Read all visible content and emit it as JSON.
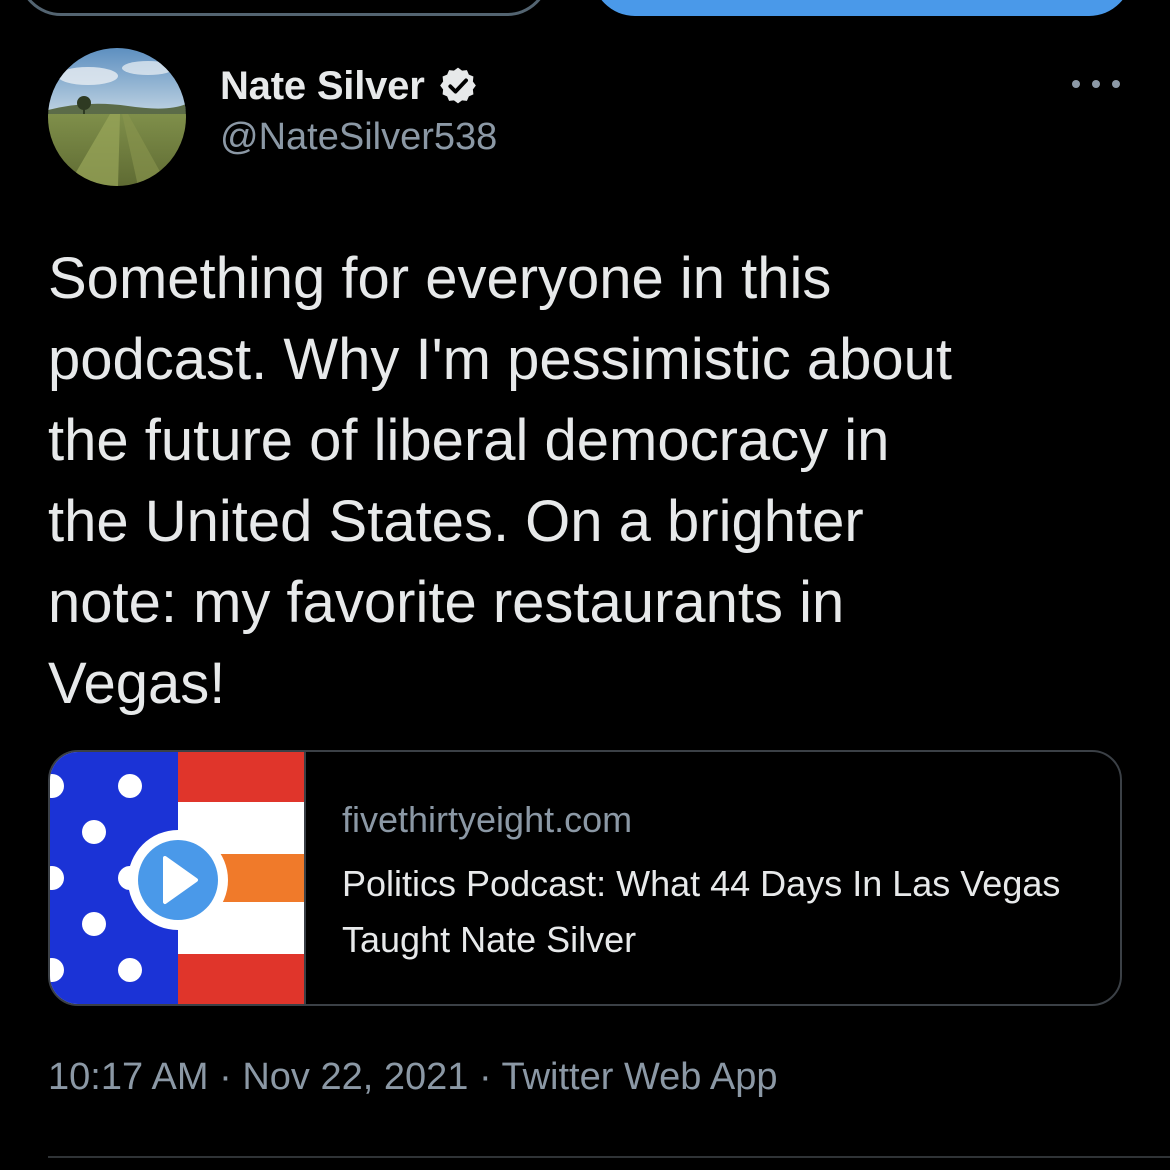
{
  "tweet": {
    "author": {
      "display_name": "Nate Silver",
      "handle": "@NateSilver538",
      "verified": true
    },
    "text": "Something for everyone in this\npodcast. Why I'm pessimistic about\nthe future of liberal democracy in\nthe United States. On a brighter\nnote: my favorite restaurants in\nVegas!",
    "card": {
      "domain": "fivethirtyeight.com",
      "title": "Politics Podcast: What 44 Days In Las Vegas Taught Nate Silver"
    },
    "meta": {
      "time": "10:17 AM",
      "separator": "·",
      "date": "Nov 22, 2021",
      "source": "Twitter Web App"
    }
  },
  "icons": {
    "verified": "verified-badge-icon",
    "more": "more-horizontal-icon",
    "play": "play-icon"
  },
  "colors": {
    "background": "#000000",
    "text_primary": "#e7e9ea",
    "text_secondary": "#8b98a5",
    "accent_blue": "#4a99e9",
    "flag_blue": "#1b33d6",
    "flag_red": "#e0352b",
    "flag_orange": "#f07a2a"
  }
}
